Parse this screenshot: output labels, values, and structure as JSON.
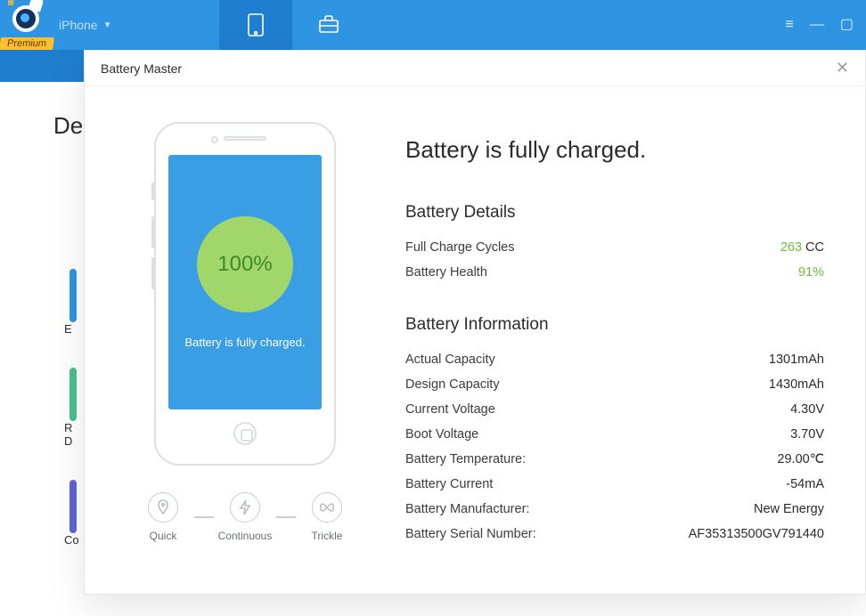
{
  "header": {
    "device_label": "iPhone",
    "premium_badge": "Premium"
  },
  "bgpage": {
    "title_fragment": "De",
    "side_labels": [
      "E",
      "R\nD",
      "Co"
    ]
  },
  "modal": {
    "title": "Battery Master",
    "headline": "Battery is fully charged.",
    "phone": {
      "percent": "100%",
      "message": "Battery is fully charged."
    },
    "modes": [
      {
        "label": "Quick"
      },
      {
        "label": "Continuous"
      },
      {
        "label": "Trickle"
      }
    ],
    "details_title": "Battery Details",
    "details": [
      {
        "label": "Full Charge Cycles",
        "value": "263",
        "unit": "CC",
        "accent": true
      },
      {
        "label": "Battery Health",
        "value": "91%",
        "unit": "",
        "accent": true
      }
    ],
    "info_title": "Battery Information",
    "info": [
      {
        "label": "Actual Capacity",
        "value": "1301mAh"
      },
      {
        "label": "Design Capacity",
        "value": "1430mAh"
      },
      {
        "label": "Current Voltage",
        "value": "4.30V"
      },
      {
        "label": "Boot Voltage",
        "value": "3.70V"
      },
      {
        "label": "Battery Temperature:",
        "value": "29.00℃"
      },
      {
        "label": "Battery Current",
        "value": "-54mA"
      },
      {
        "label": "Battery Manufacturer:",
        "value": "New Energy"
      },
      {
        "label": "Battery Serial Number:",
        "value": "AF35313500GV791440"
      }
    ]
  }
}
